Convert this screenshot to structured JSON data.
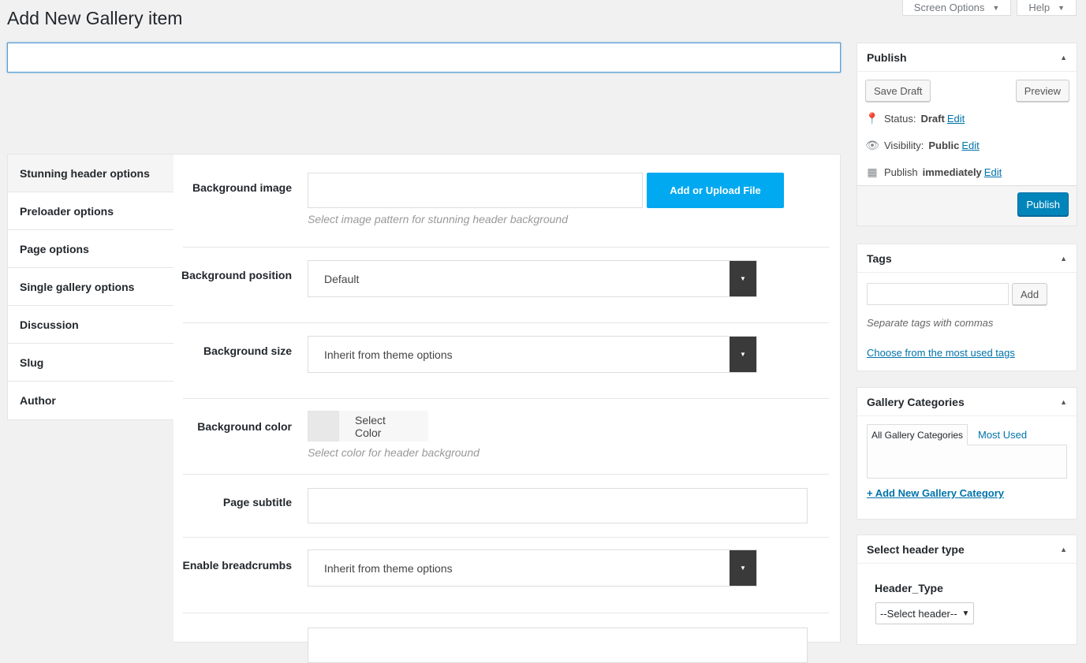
{
  "top_tabs": [
    {
      "label": "Screen Options"
    },
    {
      "label": "Help"
    }
  ],
  "page": {
    "title": "Add New Gallery item",
    "title_input_value": ""
  },
  "options_tabs": [
    {
      "label": "Stunning header options"
    },
    {
      "label": "Preloader options"
    },
    {
      "label": "Page options"
    },
    {
      "label": "Single gallery options"
    },
    {
      "label": "Discussion"
    },
    {
      "label": "Slug"
    },
    {
      "label": "Author"
    }
  ],
  "fields": {
    "bg_image": {
      "label": "Background image",
      "button": "Add or Upload File",
      "hint": "Select image pattern for stunning header background"
    },
    "bg_position": {
      "label": "Background position",
      "value": "Default"
    },
    "bg_size": {
      "label": "Background size",
      "value": "Inherit from theme options"
    },
    "bg_color": {
      "label": "Background color",
      "button": "Select Color",
      "hint": "Select color for header background"
    },
    "subtitle": {
      "label": "Page subtitle"
    },
    "breadcrumbs": {
      "label": "Enable breadcrumbs",
      "value": "Inherit from theme options"
    }
  },
  "publish": {
    "title": "Publish",
    "save_draft": "Save Draft",
    "preview": "Preview",
    "status_label": "Status:",
    "status_value": "Draft",
    "visibility_label": "Visibility:",
    "visibility_value": "Public",
    "publish_label": "Publish",
    "publish_value": "immediately",
    "edit": "Edit",
    "publish_button": "Publish"
  },
  "tags": {
    "title": "Tags",
    "add": "Add",
    "hint": "Separate tags with commas",
    "most_used_link": "Choose from the most used tags"
  },
  "gallery_categories": {
    "title": "Gallery Categories",
    "tab_all": "All Gallery Categories",
    "tab_most": "Most Used",
    "add_link": "+ Add New Gallery Category"
  },
  "header_type": {
    "title": "Select header type",
    "label": "Header_Type",
    "selected": "--Select header--"
  },
  "colors": {
    "accent": "#0085ba",
    "upload": "#00a9f0",
    "link": "#0073aa"
  }
}
